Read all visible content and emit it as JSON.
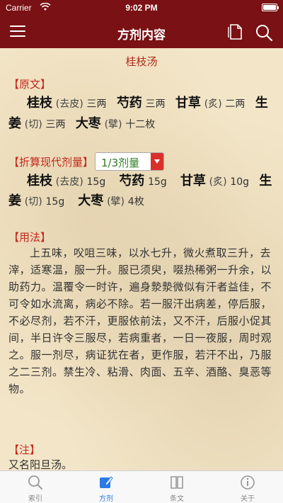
{
  "status": {
    "carrier": "Carrier",
    "time": "9:02 PM"
  },
  "nav": {
    "title": "方剂内容"
  },
  "recipe": {
    "title": "桂枝汤",
    "original_header": "【原文】",
    "original_line1": [
      {
        "herb": "桂枝",
        "note": "(去皮)",
        "dose": "三两"
      },
      {
        "herb": "芍药",
        "note": "",
        "dose": "三两"
      },
      {
        "herb": "甘草",
        "note": "(炙)",
        "dose": "二两"
      },
      {
        "herb": "生",
        "note": "",
        "dose": ""
      }
    ],
    "original_line2": [
      {
        "herb": "姜",
        "note": "(切)",
        "dose": "三两"
      },
      {
        "herb": "大枣",
        "note": "(擘)",
        "dose": "十二枚"
      }
    ],
    "modern_header": "【折算现代剂量】",
    "dose_select": "1/3剂量",
    "modern_line1": [
      {
        "herb": "桂枝",
        "note": "(去皮)",
        "dose": "15g"
      },
      {
        "herb": "芍药",
        "note": "",
        "dose": "15g"
      },
      {
        "herb": "甘草",
        "note": "(炙)",
        "dose": "10g"
      },
      {
        "herb": "生",
        "note": "",
        "dose": ""
      }
    ],
    "modern_line2": [
      {
        "herb": "姜",
        "note": "(切)",
        "dose": "15g"
      },
      {
        "herb": "大枣",
        "note": "(擘)",
        "dose": "4枚"
      }
    ],
    "usage_header": "【用法】",
    "usage_text": "上五味，㕮咀三味，以水七升，微火煮取三升，去滓，适寒温，服一升。服已须臾，啜热稀粥一升余，以助药力。温覆令一时许，遍身漐漐微似有汗者益佳，不可令如水流离，病必不除。若一服汗出病差，停后服，不必尽剂，若不汗，更服依前法，又不汗，后服小促其间，半日许令三服尽，若病重者，一日一夜服，周时观之。服一剂尽，病证犹在者，更作服，若汗不出，乃服之二三剂。禁生冷、粘滑、肉面、五辛、酒酪、臭恶等物。",
    "notes_header": "【注】",
    "notes_text": "又名阳旦汤。"
  },
  "tabs": [
    {
      "label": "索引",
      "icon": "search-icon"
    },
    {
      "label": "方剂",
      "icon": "edit-icon"
    },
    {
      "label": "条文",
      "icon": "book-icon"
    },
    {
      "label": "关于",
      "icon": "info-icon"
    }
  ],
  "colors": {
    "brand": "#7a1114",
    "accent_red": "#c4281c",
    "active_tab": "#2a7be4",
    "select_green": "#2f7d23"
  }
}
